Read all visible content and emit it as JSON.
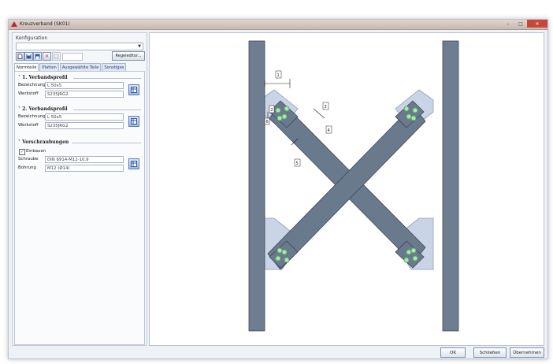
{
  "window": {
    "title": "Kreuzverband (SK01)"
  },
  "konfiguration": {
    "label": "Konfiguration",
    "value": ""
  },
  "toolbar": {
    "regel_label": "Regeleditor..."
  },
  "tabs": [
    {
      "label": "Normteile",
      "active": true
    },
    {
      "label": "Platten",
      "active": false
    },
    {
      "label": "Ausgewählte Teile",
      "active": false
    },
    {
      "label": "Sonstiges",
      "active": false
    }
  ],
  "profil1": {
    "title": "1. Verbandsprofil",
    "bezeichnung_label": "Bezeichnung",
    "bezeichnung_value": "L 50x5",
    "werkstoff_label": "Werkstoff",
    "werkstoff_value": "S235JRG2"
  },
  "profil2": {
    "title": "2. Verbandsprofil",
    "bezeichnung_label": "Bezeichnung",
    "bezeichnung_value": "L 50x5",
    "werkstoff_label": "Werkstoff",
    "werkstoff_value": "S235JRG2"
  },
  "verschraubungen": {
    "title": "Verschraubungen",
    "einbauen_label": "Einbauen",
    "einbauen_checked": true,
    "schraube_label": "Schraube",
    "schraube_value": "DIN 6914-M12-10.9",
    "bohrung_label": "Bohrung",
    "bohrung_value": "M12 (Ø14)"
  },
  "drawing": {
    "dim_labels": [
      "1",
      "2",
      "3",
      "4",
      "5",
      "6"
    ]
  },
  "buttons": {
    "ok": "OK",
    "close": "Schließen",
    "apply": "Übernehmen"
  },
  "colors": {
    "column": "#6e7d8f",
    "brace": "#6a7a8d",
    "plate": "#c9d5e6",
    "bolt": "#b6e3a8"
  }
}
